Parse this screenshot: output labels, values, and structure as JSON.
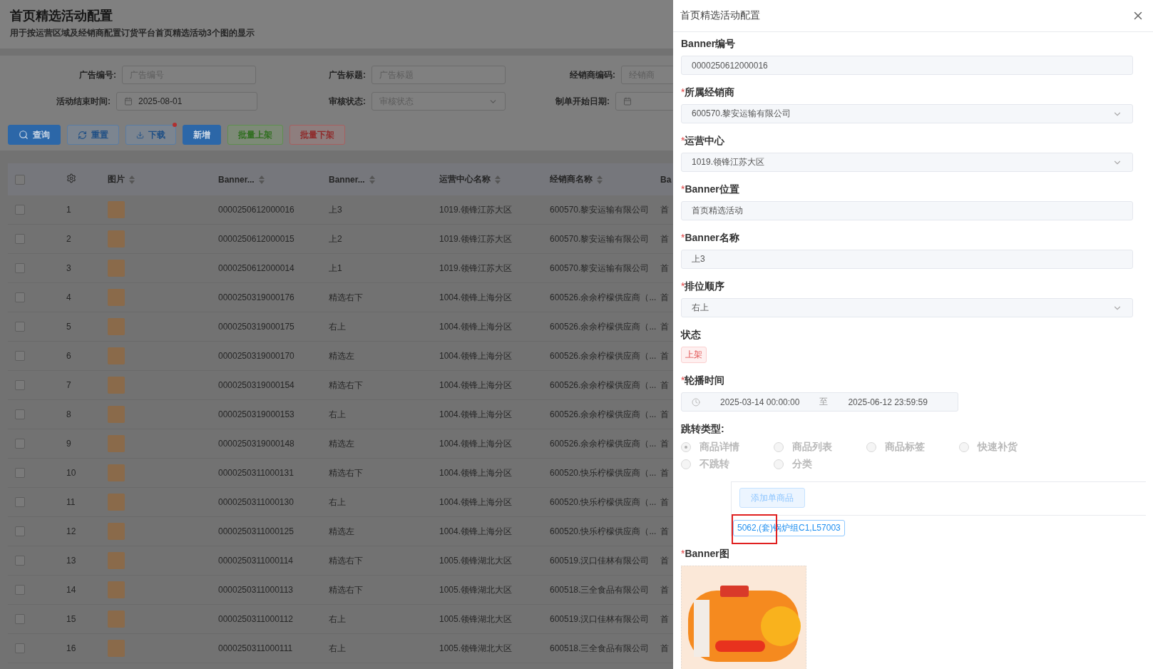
{
  "page": {
    "title": "首页精选活动配置",
    "subtitle": "用于按运营区域及经销商配置订货平台首页精选活动3个图的显示"
  },
  "filters": [
    {
      "label": "广告编号:",
      "kind": "text",
      "placeholder": "广告编号"
    },
    {
      "label": "广告标题:",
      "kind": "text",
      "placeholder": "广告标题"
    },
    {
      "label": "经销商编码:",
      "kind": "text",
      "placeholder": "经销商"
    },
    {
      "label": "活动结束时间:",
      "kind": "date",
      "value": "2025-08-01"
    },
    {
      "label": "审核状态:",
      "kind": "select",
      "placeholder": "审核状态"
    },
    {
      "label": "制单开始日期:",
      "kind": "date"
    }
  ],
  "buttons": [
    {
      "label": "查询",
      "kind": "search",
      "dot": false
    },
    {
      "label": "重置",
      "kind": "reset",
      "dot": false
    },
    {
      "label": "下载",
      "kind": "download",
      "dot": true
    },
    {
      "label": "新增",
      "kind": "add",
      "dot": false
    },
    {
      "label": "批量上架",
      "kind": "batch-on",
      "dot": false
    },
    {
      "label": "批量下架",
      "kind": "batch-off",
      "dot": false
    }
  ],
  "table": {
    "all_checked": false,
    "image_column": {
      "label": "图片",
      "sortable": true
    },
    "columns": [
      {
        "label": "Banner...",
        "sortable": true
      },
      {
        "label": "Banner...",
        "sortable": true
      },
      {
        "label": "运营中心名称",
        "sortable": true
      },
      {
        "label": "经销商名称",
        "sortable": true
      },
      {
        "label": "Ba"
      }
    ],
    "rows": [
      {
        "checked": false,
        "index": "1",
        "cells": [
          "0000250612000016",
          "上3",
          "1019.领锋江苏大区",
          "600570.黎安运输有限公司",
          "首"
        ]
      },
      {
        "checked": false,
        "index": "2",
        "cells": [
          "0000250612000015",
          "上2",
          "1019.领锋江苏大区",
          "600570.黎安运输有限公司",
          "首"
        ]
      },
      {
        "checked": false,
        "index": "3",
        "cells": [
          "0000250612000014",
          "上1",
          "1019.领锋江苏大区",
          "600570.黎安运输有限公司",
          "首"
        ]
      },
      {
        "checked": false,
        "index": "4",
        "cells": [
          "0000250319000176",
          "精选右下",
          "1004.领锋上海分区",
          "600526.余余柠檬供应商（...",
          "首"
        ]
      },
      {
        "checked": false,
        "index": "5",
        "cells": [
          "0000250319000175",
          "右上",
          "1004.领锋上海分区",
          "600526.余余柠檬供应商（...",
          "首"
        ]
      },
      {
        "checked": false,
        "index": "6",
        "cells": [
          "0000250319000170",
          "精选左",
          "1004.领锋上海分区",
          "600526.余余柠檬供应商（...",
          "首"
        ]
      },
      {
        "checked": false,
        "index": "7",
        "cells": [
          "0000250319000154",
          "精选右下",
          "1004.领锋上海分区",
          "600526.余余柠檬供应商（...",
          "首"
        ]
      },
      {
        "checked": false,
        "index": "8",
        "cells": [
          "0000250319000153",
          "右上",
          "1004.领锋上海分区",
          "600526.余余柠檬供应商（...",
          "首"
        ]
      },
      {
        "checked": false,
        "index": "9",
        "cells": [
          "0000250319000148",
          "精选左",
          "1004.领锋上海分区",
          "600526.余余柠檬供应商（...",
          "首"
        ]
      },
      {
        "checked": false,
        "index": "10",
        "cells": [
          "0000250311000131",
          "精选右下",
          "1004.领锋上海分区",
          "600520.快乐柠檬供应商（...",
          "首"
        ]
      },
      {
        "checked": false,
        "index": "11",
        "cells": [
          "0000250311000130",
          "右上",
          "1004.领锋上海分区",
          "600520.快乐柠檬供应商（...",
          "首"
        ]
      },
      {
        "checked": false,
        "index": "12",
        "cells": [
          "0000250311000125",
          "精选左",
          "1004.领锋上海分区",
          "600520.快乐柠檬供应商（...",
          "首"
        ]
      },
      {
        "checked": false,
        "index": "13",
        "cells": [
          "0000250311000114",
          "精选右下",
          "1005.领锋湖北大区",
          "600519.汉口佳林有限公司",
          "首"
        ]
      },
      {
        "checked": false,
        "index": "14",
        "cells": [
          "0000250311000113",
          "精选右下",
          "1005.领锋湖北大区",
          "600518.三全食品有限公司",
          "首"
        ]
      },
      {
        "checked": false,
        "index": "15",
        "cells": [
          "0000250311000112",
          "右上",
          "1005.领锋湖北大区",
          "600519.汉口佳林有限公司",
          "首"
        ]
      },
      {
        "checked": false,
        "index": "16",
        "cells": [
          "0000250311000111",
          "右上",
          "1005.领锋湖北大区",
          "600518.三全食品有限公司",
          "首"
        ]
      }
    ]
  },
  "drawer": {
    "title": "首页精选活动配置",
    "fields": [
      {
        "label": "Banner编号",
        "kind": "input",
        "value": "0000250612000016"
      },
      {
        "label": "所属经销商",
        "required_mark": "*",
        "kind": "select",
        "value": "600570.黎安运输有限公司"
      },
      {
        "label": "运营中心",
        "required_mark": "*",
        "kind": "select",
        "value": "1019.领锋江苏大区"
      },
      {
        "label": "Banner位置",
        "required_mark": "*",
        "kind": "input",
        "value": "首页精选活动"
      },
      {
        "label": "Banner名称",
        "required_mark": "*",
        "kind": "input",
        "value": "上3"
      },
      {
        "label": "排位顺序",
        "required_mark": "*",
        "kind": "select",
        "value": "右上"
      },
      {
        "label": "状态",
        "kind": "tag",
        "value": "上架"
      },
      {
        "label": "轮播时间",
        "required_mark": "*",
        "kind": "daterange",
        "start": "2025-03-14 00:00:00",
        "separator": "至",
        "end": "2025-06-12 23:59:59"
      }
    ],
    "jump": {
      "label": "跳转类型:",
      "options": [
        {
          "label": "商品详情",
          "selected": true
        },
        {
          "label": "商品列表",
          "selected": false
        },
        {
          "label": "商品标签",
          "selected": false
        },
        {
          "label": "快速补货",
          "selected": false
        },
        {
          "label": "不跳转",
          "selected": false
        },
        {
          "label": "分类",
          "selected": false
        }
      ],
      "add_button": "添加单商品",
      "product_tag": "5062,(套)锅炉组C1,L57003"
    },
    "banner": {
      "label": "Banner图",
      "required_mark": "*"
    }
  }
}
